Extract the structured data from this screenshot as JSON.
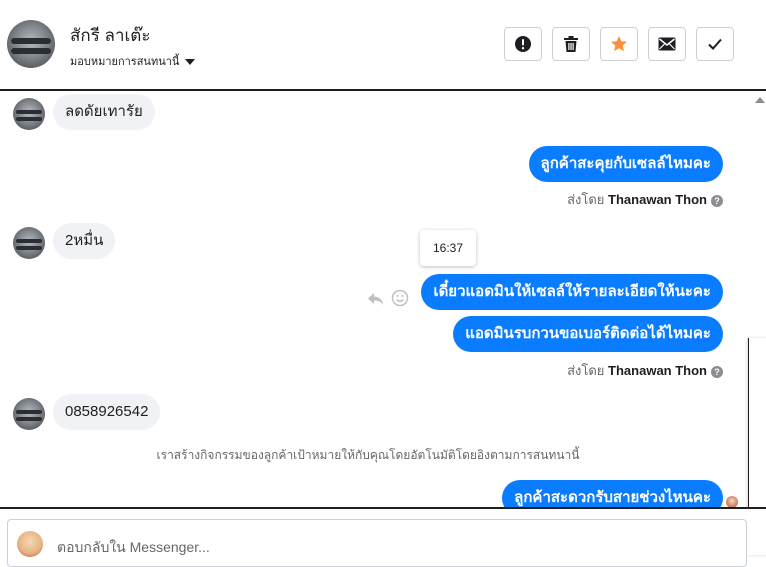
{
  "header": {
    "name": "สักรี ลาเต๊ะ",
    "assign": "มอบหมายการสนทนานี้",
    "actions": [
      "exclamation-icon",
      "trash-icon",
      "star-icon",
      "envelope-icon",
      "check-icon"
    ],
    "star_color": "#f7923a"
  },
  "messages": {
    "m1": "ลดดัยเทารัย",
    "m2": "ลูกค้าสะคุยกับเซลล์ไหมคะ",
    "sent_by_prefix": "ส่งโดย",
    "sent_by_name": "Thanawan Thon",
    "m3": "2หมื่น",
    "time": "16:37",
    "m4": "เดี๋ยวแอดมินให้เซลล์ให้รายละเอียดให้นะคะ",
    "m5": "แอดมินรบกวนขอเบอร์ติดต่อได้ไหมคะ",
    "m6": "0858926542",
    "system": "เราสร้างกิจกรรมของลูกค้าเป้าหมายให้กับคุณโดยอัตโนมัติโดยอิงตามการสนทนานี้",
    "m7": "ลูกค้าสะดวกรับสายช่วงไหนคะ",
    "outgoing_color": "#0a7cff"
  },
  "reply": {
    "placeholder": "ตอบกลับใน Messenger..."
  }
}
